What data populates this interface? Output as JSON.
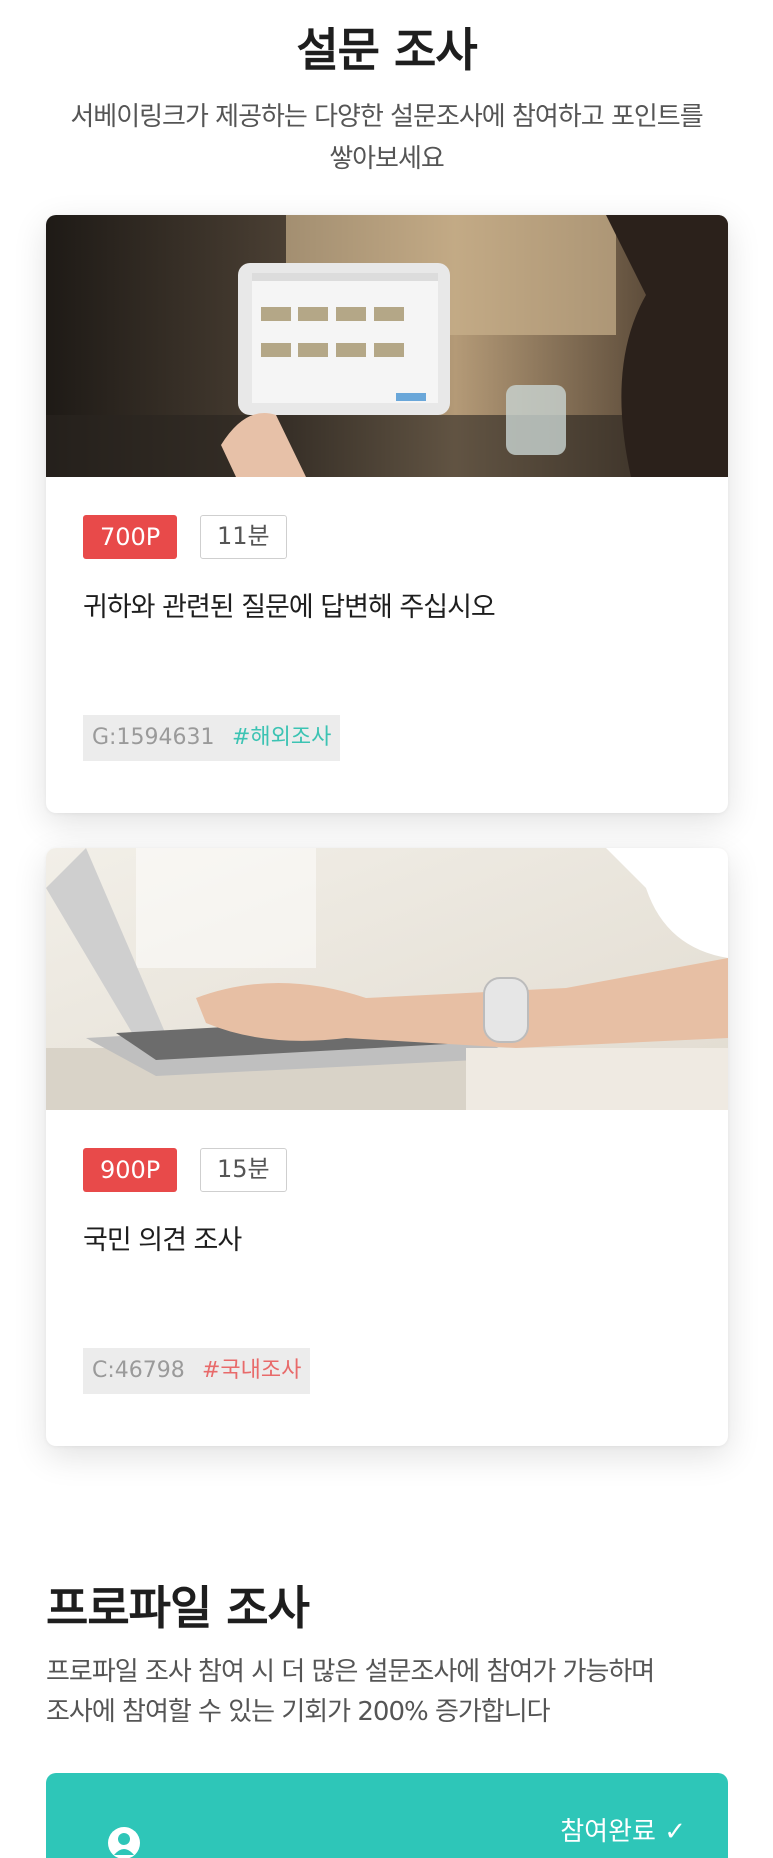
{
  "survey": {
    "title": "설문 조사",
    "subtitle_line1": "서베이링크가 제공하는 다양한 설문조사에 참여하고 포인트를",
    "subtitle_line2": "쌓아보세요",
    "cards": [
      {
        "points": "700P",
        "duration": "11분",
        "title": "귀하와 관련된 질문에 답변해 주십시오",
        "code": "G:1594631",
        "category": "#해외조사",
        "category_color": "#3cc3b3"
      },
      {
        "points": "900P",
        "duration": "15분",
        "title": "국민 의견 조사",
        "code": "C:46798",
        "category": "#국내조사",
        "category_color": "#e86a6a"
      }
    ]
  },
  "profile": {
    "title": "프로파일 조사",
    "subtitle_line1": "프로파일 조사 참여 시 더 많은 설문조사에 참여가 가능하며",
    "subtitle_line2": "조사에 참여할 수 있는 기회가 200% 증가합니다",
    "status": "참여완료 ✓",
    "bg_color": "#2ec6b8"
  },
  "colors": {
    "point_badge": "#e84a4a",
    "accent": "#2ec6b8"
  }
}
